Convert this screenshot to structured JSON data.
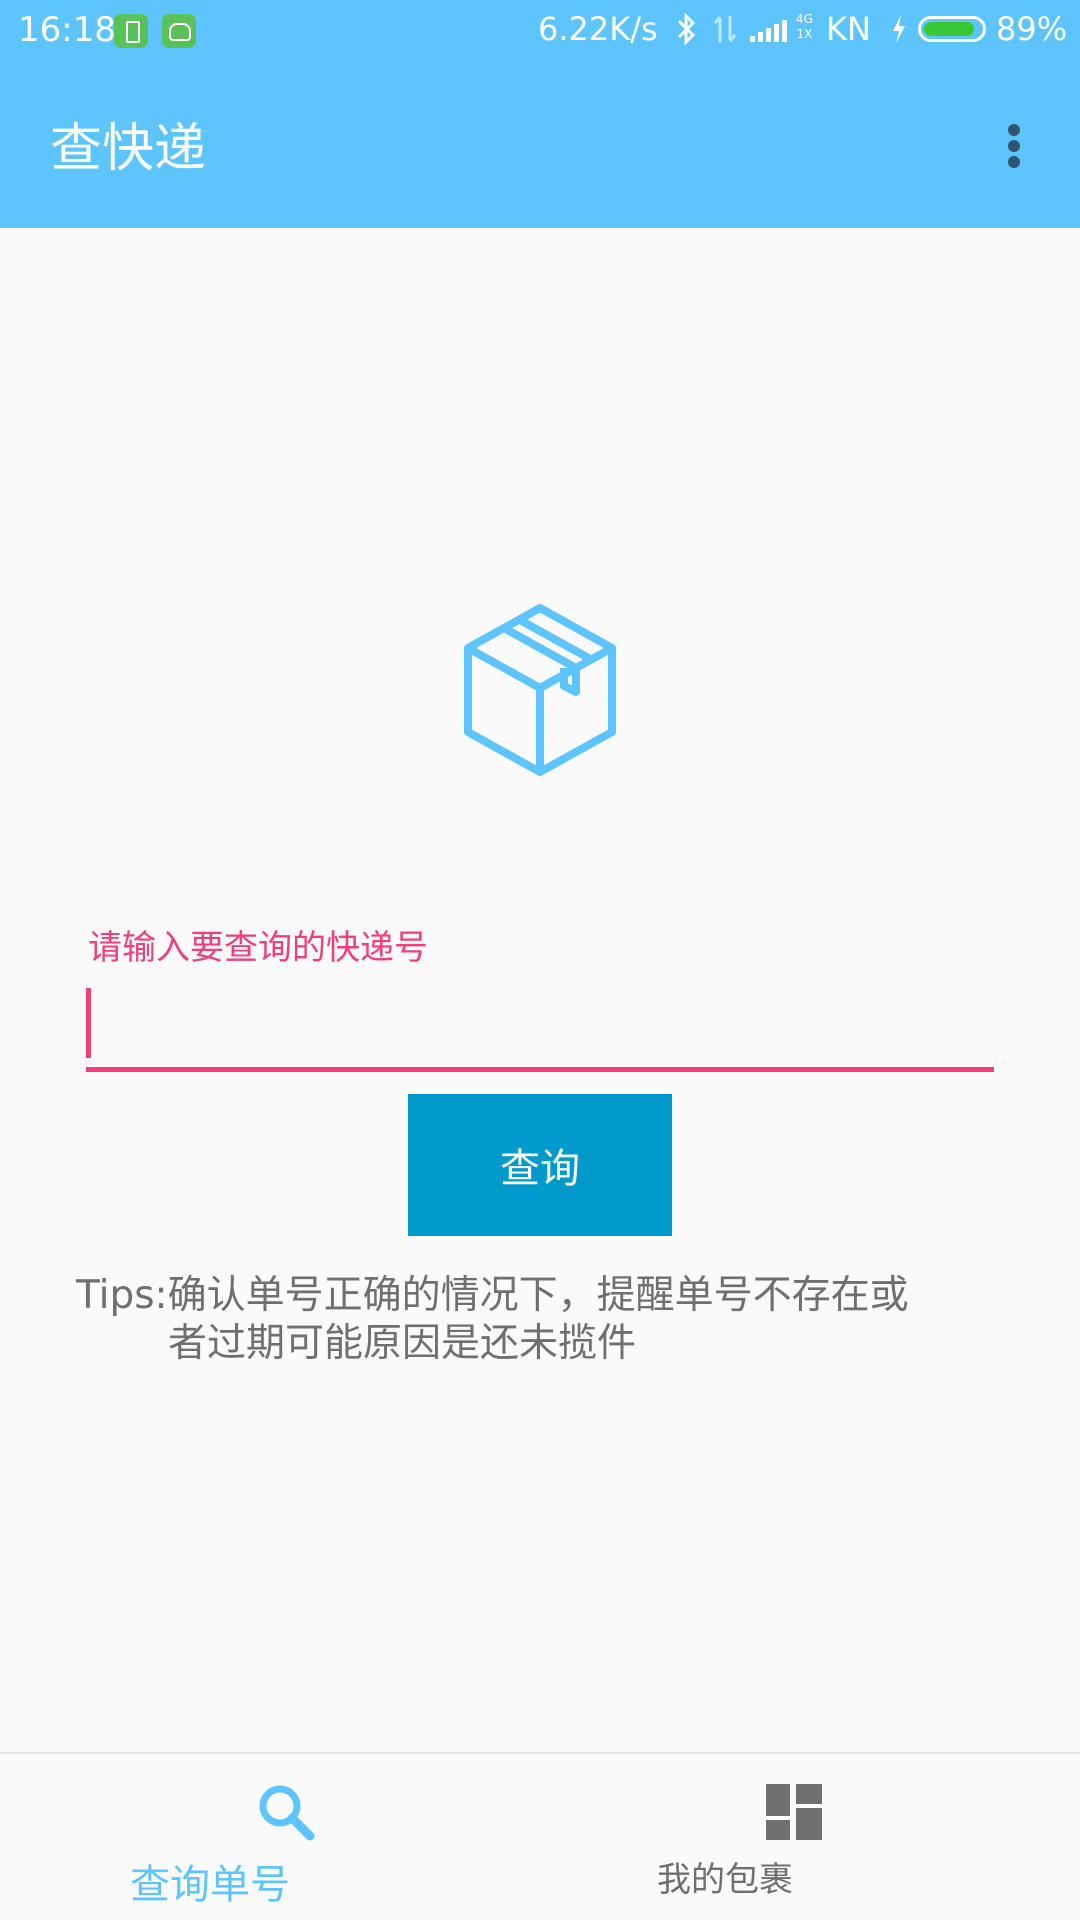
{
  "status_bar": {
    "time": "16:18",
    "net_speed": "6.22K/s",
    "network_type_top": "4G",
    "network_type_bottom": "1X",
    "carrier": "KN",
    "battery_percent_label": "89%",
    "battery_level": 0.89,
    "icons": [
      "battery-app-icon",
      "android-app-icon",
      "bluetooth-icon",
      "data-transfer-icon",
      "signal-icon",
      "charging-icon",
      "battery-icon"
    ],
    "battery_color": "#38c936"
  },
  "app_bar": {
    "title": "查快递",
    "menu_icon": "overflow-menu-icon",
    "background_color": "#5ec4fd"
  },
  "main": {
    "illustration_icon": "package-box-icon",
    "input": {
      "label": "请输入要查询的快递号",
      "value": "",
      "accent_color": "#f13f78"
    },
    "query_button": {
      "label": "查询",
      "color": "#0099cc"
    },
    "tips": {
      "line1": "Tips:确认单号正确的情况下，提醒单号不存在或",
      "line2": "者过期可能原因是还未揽件"
    }
  },
  "bottom_nav": {
    "items": [
      {
        "label": "查询单号",
        "icon": "search-icon",
        "active": true
      },
      {
        "label": "我的包裹",
        "icon": "dashboard-grid-icon",
        "active": false
      }
    ],
    "active_color": "#5ec4fd",
    "inactive_color": "#6f6f6f"
  }
}
